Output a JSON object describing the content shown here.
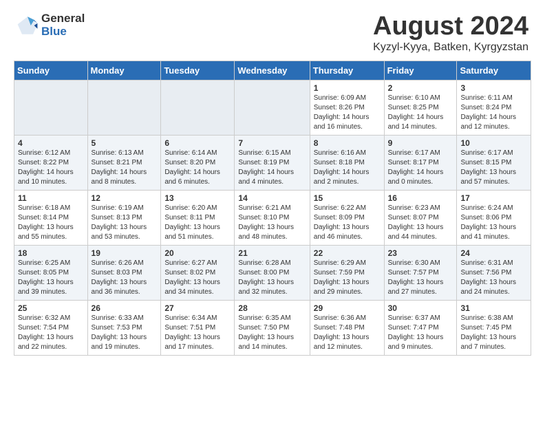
{
  "header": {
    "logo_general": "General",
    "logo_blue": "Blue",
    "month_title": "August 2024",
    "location": "Kyzyl-Kyya, Batken, Kyrgyzstan"
  },
  "weekdays": [
    "Sunday",
    "Monday",
    "Tuesday",
    "Wednesday",
    "Thursday",
    "Friday",
    "Saturday"
  ],
  "weeks": [
    [
      {
        "day": "",
        "text": ""
      },
      {
        "day": "",
        "text": ""
      },
      {
        "day": "",
        "text": ""
      },
      {
        "day": "",
        "text": ""
      },
      {
        "day": "1",
        "text": "Sunrise: 6:09 AM\nSunset: 8:26 PM\nDaylight: 14 hours and 16 minutes."
      },
      {
        "day": "2",
        "text": "Sunrise: 6:10 AM\nSunset: 8:25 PM\nDaylight: 14 hours and 14 minutes."
      },
      {
        "day": "3",
        "text": "Sunrise: 6:11 AM\nSunset: 8:24 PM\nDaylight: 14 hours and 12 minutes."
      }
    ],
    [
      {
        "day": "4",
        "text": "Sunrise: 6:12 AM\nSunset: 8:22 PM\nDaylight: 14 hours and 10 minutes."
      },
      {
        "day": "5",
        "text": "Sunrise: 6:13 AM\nSunset: 8:21 PM\nDaylight: 14 hours and 8 minutes."
      },
      {
        "day": "6",
        "text": "Sunrise: 6:14 AM\nSunset: 8:20 PM\nDaylight: 14 hours and 6 minutes."
      },
      {
        "day": "7",
        "text": "Sunrise: 6:15 AM\nSunset: 8:19 PM\nDaylight: 14 hours and 4 minutes."
      },
      {
        "day": "8",
        "text": "Sunrise: 6:16 AM\nSunset: 8:18 PM\nDaylight: 14 hours and 2 minutes."
      },
      {
        "day": "9",
        "text": "Sunrise: 6:17 AM\nSunset: 8:17 PM\nDaylight: 14 hours and 0 minutes."
      },
      {
        "day": "10",
        "text": "Sunrise: 6:17 AM\nSunset: 8:15 PM\nDaylight: 13 hours and 57 minutes."
      }
    ],
    [
      {
        "day": "11",
        "text": "Sunrise: 6:18 AM\nSunset: 8:14 PM\nDaylight: 13 hours and 55 minutes."
      },
      {
        "day": "12",
        "text": "Sunrise: 6:19 AM\nSunset: 8:13 PM\nDaylight: 13 hours and 53 minutes."
      },
      {
        "day": "13",
        "text": "Sunrise: 6:20 AM\nSunset: 8:11 PM\nDaylight: 13 hours and 51 minutes."
      },
      {
        "day": "14",
        "text": "Sunrise: 6:21 AM\nSunset: 8:10 PM\nDaylight: 13 hours and 48 minutes."
      },
      {
        "day": "15",
        "text": "Sunrise: 6:22 AM\nSunset: 8:09 PM\nDaylight: 13 hours and 46 minutes."
      },
      {
        "day": "16",
        "text": "Sunrise: 6:23 AM\nSunset: 8:07 PM\nDaylight: 13 hours and 44 minutes."
      },
      {
        "day": "17",
        "text": "Sunrise: 6:24 AM\nSunset: 8:06 PM\nDaylight: 13 hours and 41 minutes."
      }
    ],
    [
      {
        "day": "18",
        "text": "Sunrise: 6:25 AM\nSunset: 8:05 PM\nDaylight: 13 hours and 39 minutes."
      },
      {
        "day": "19",
        "text": "Sunrise: 6:26 AM\nSunset: 8:03 PM\nDaylight: 13 hours and 36 minutes."
      },
      {
        "day": "20",
        "text": "Sunrise: 6:27 AM\nSunset: 8:02 PM\nDaylight: 13 hours and 34 minutes."
      },
      {
        "day": "21",
        "text": "Sunrise: 6:28 AM\nSunset: 8:00 PM\nDaylight: 13 hours and 32 minutes."
      },
      {
        "day": "22",
        "text": "Sunrise: 6:29 AM\nSunset: 7:59 PM\nDaylight: 13 hours and 29 minutes."
      },
      {
        "day": "23",
        "text": "Sunrise: 6:30 AM\nSunset: 7:57 PM\nDaylight: 13 hours and 27 minutes."
      },
      {
        "day": "24",
        "text": "Sunrise: 6:31 AM\nSunset: 7:56 PM\nDaylight: 13 hours and 24 minutes."
      }
    ],
    [
      {
        "day": "25",
        "text": "Sunrise: 6:32 AM\nSunset: 7:54 PM\nDaylight: 13 hours and 22 minutes."
      },
      {
        "day": "26",
        "text": "Sunrise: 6:33 AM\nSunset: 7:53 PM\nDaylight: 13 hours and 19 minutes."
      },
      {
        "day": "27",
        "text": "Sunrise: 6:34 AM\nSunset: 7:51 PM\nDaylight: 13 hours and 17 minutes."
      },
      {
        "day": "28",
        "text": "Sunrise: 6:35 AM\nSunset: 7:50 PM\nDaylight: 13 hours and 14 minutes."
      },
      {
        "day": "29",
        "text": "Sunrise: 6:36 AM\nSunset: 7:48 PM\nDaylight: 13 hours and 12 minutes."
      },
      {
        "day": "30",
        "text": "Sunrise: 6:37 AM\nSunset: 7:47 PM\nDaylight: 13 hours and 9 minutes."
      },
      {
        "day": "31",
        "text": "Sunrise: 6:38 AM\nSunset: 7:45 PM\nDaylight: 13 hours and 7 minutes."
      }
    ]
  ]
}
